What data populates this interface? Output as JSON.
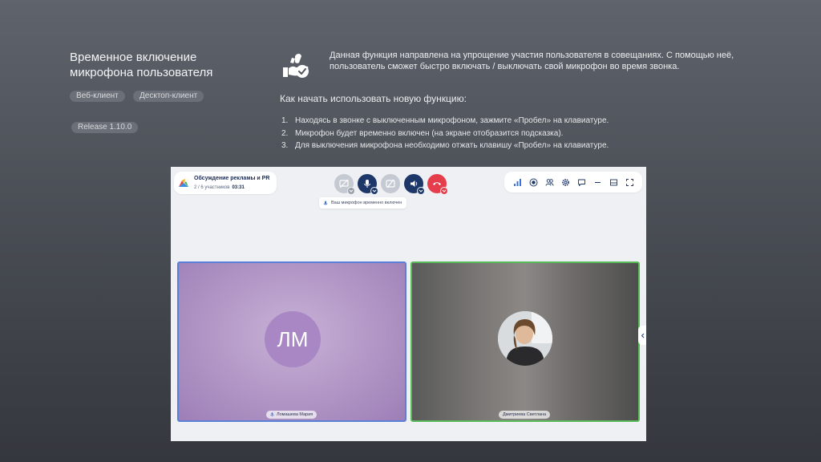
{
  "feature": {
    "title": "Временное включение микрофона пользователя",
    "tags": [
      "Веб-клиент",
      "Десктоп-клиент"
    ],
    "release": "Release 1.10.0",
    "icon": "hand-mic-check-icon",
    "description": "Данная функция направлена на упрощение участия пользователя в совещаниях. С помощью неё, пользователь сможет быстро включать / выключать свой микрофон во время звонка.",
    "howto_title": "Как начать использовать новую функцию:",
    "steps": [
      "Находясь в звонке с выключенным микрофоном, зажмите «Пробел» на клавиатуре.",
      "Микрофон будет временно включен (на экране отобразится подсказка).",
      "Для выключения микрофона необходимо отжать клавишу «Пробел» на клавиатуре."
    ],
    "step_numbers": [
      "1.",
      "2.",
      "3."
    ]
  },
  "app": {
    "meeting": {
      "name": "Обсуждение рекламы и PR",
      "participants": "2 / 6 участников",
      "timer": "03:31"
    },
    "controls": [
      "screen-share-off-icon",
      "microphone-icon",
      "camera-off-icon",
      "speaker-icon",
      "hangup-icon"
    ],
    "hint": "Ваш микрофон временно включен",
    "toolbar": [
      "signal-icon",
      "record-icon",
      "participants-icon",
      "settings-icon",
      "chat-icon",
      "minimize-icon",
      "layout-icon",
      "fullscreen-icon"
    ],
    "participants": [
      {
        "initials": "ЛМ",
        "name": "Ломашева Мария"
      },
      {
        "initials": "",
        "name": "Дмитриева Светлана"
      }
    ],
    "colors": {
      "navy": "#1c3768",
      "red": "#e63d4c",
      "speaking_border": "#57b957",
      "active_border": "#5a7fd6"
    }
  }
}
